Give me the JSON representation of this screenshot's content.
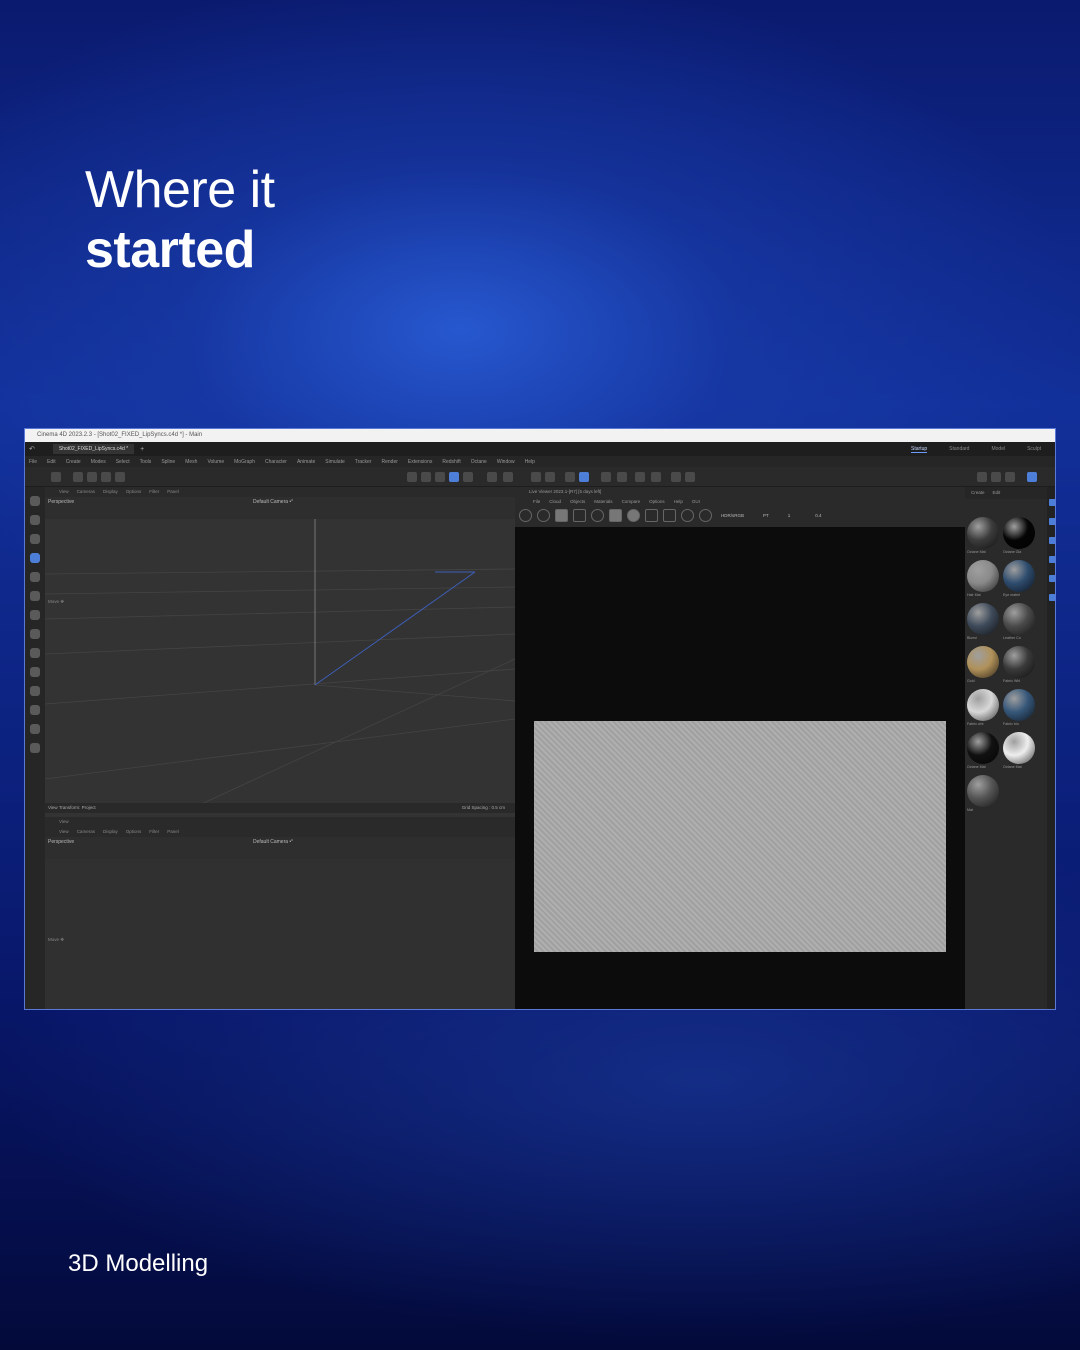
{
  "headline": {
    "line1": "Where it",
    "line2": "started"
  },
  "footer": {
    "label": "3D Modelling"
  },
  "app": {
    "window_title": "Cinema 4D 2023.2.3 - [Shot02_FIXED_LipSyncs.c4d *] - Main",
    "file_tab": "Shot02_FIXED_LipSyncs.c4d *",
    "layouts": [
      "Startup",
      "Standard",
      "Model",
      "Sculpt"
    ],
    "active_layout": "Startup",
    "menus": [
      "File",
      "Edit",
      "Create",
      "Modes",
      "Select",
      "Tools",
      "Spline",
      "Mesh",
      "Volume",
      "MoGraph",
      "Character",
      "Animate",
      "Simulate",
      "Tracker",
      "Render",
      "Extensions",
      "Redshift",
      "Octane",
      "Window",
      "Help"
    ],
    "viewport_menu": [
      "View",
      "Cameras",
      "Display",
      "Options",
      "Filter",
      "Panel"
    ],
    "viewport_top": {
      "label": "Perspective",
      "camera": "Default Camera •°",
      "move": "Move ✥",
      "footer_left": "View Transform: Project",
      "footer_right": "Grid Spacing : 0.5 cm"
    },
    "viewport_bottom": {
      "title": "View",
      "label": "Perspective",
      "camera": "Default Camera •°",
      "move": "Move ✥"
    },
    "live_viewer": {
      "title": "Live Viewer 2023.1-[R7] [5 days left]",
      "menu": [
        "File",
        "Cloud",
        "Objects",
        "Materials",
        "Compare",
        "Options",
        "Help",
        "GUI"
      ],
      "mode": "HDR/sRGB",
      "channel": "PT",
      "value_a": "1",
      "value_b": "0.4"
    },
    "materials_panel": {
      "menu": [
        "Create",
        "Edit"
      ],
      "materials": [
        {
          "name": "Octane Mat",
          "color": "#3c3c3c"
        },
        {
          "name": "Octane Gla",
          "color": "#050505"
        },
        {
          "name": "Hair Mat",
          "color": "#8a8a8a"
        },
        {
          "name": "Eye materi",
          "color": "#2e4c6e"
        },
        {
          "name": "Bluesi",
          "color": "#3e4a5a"
        },
        {
          "name": "Leather Co",
          "color": "#4a4a4a"
        },
        {
          "name": "Gold",
          "color": "#b0915a"
        },
        {
          "name": "Fabric Whi",
          "color": "#3a3a3a"
        },
        {
          "name": "Fabric whi",
          "color": "#d8d8d8"
        },
        {
          "name": "Fabric blu",
          "color": "#36577a"
        },
        {
          "name": "Octane Mat",
          "color": "#111111"
        },
        {
          "name": "Octane Mat",
          "color": "#eeeeee"
        },
        {
          "name": "Mat",
          "color": "#555555"
        }
      ]
    }
  }
}
